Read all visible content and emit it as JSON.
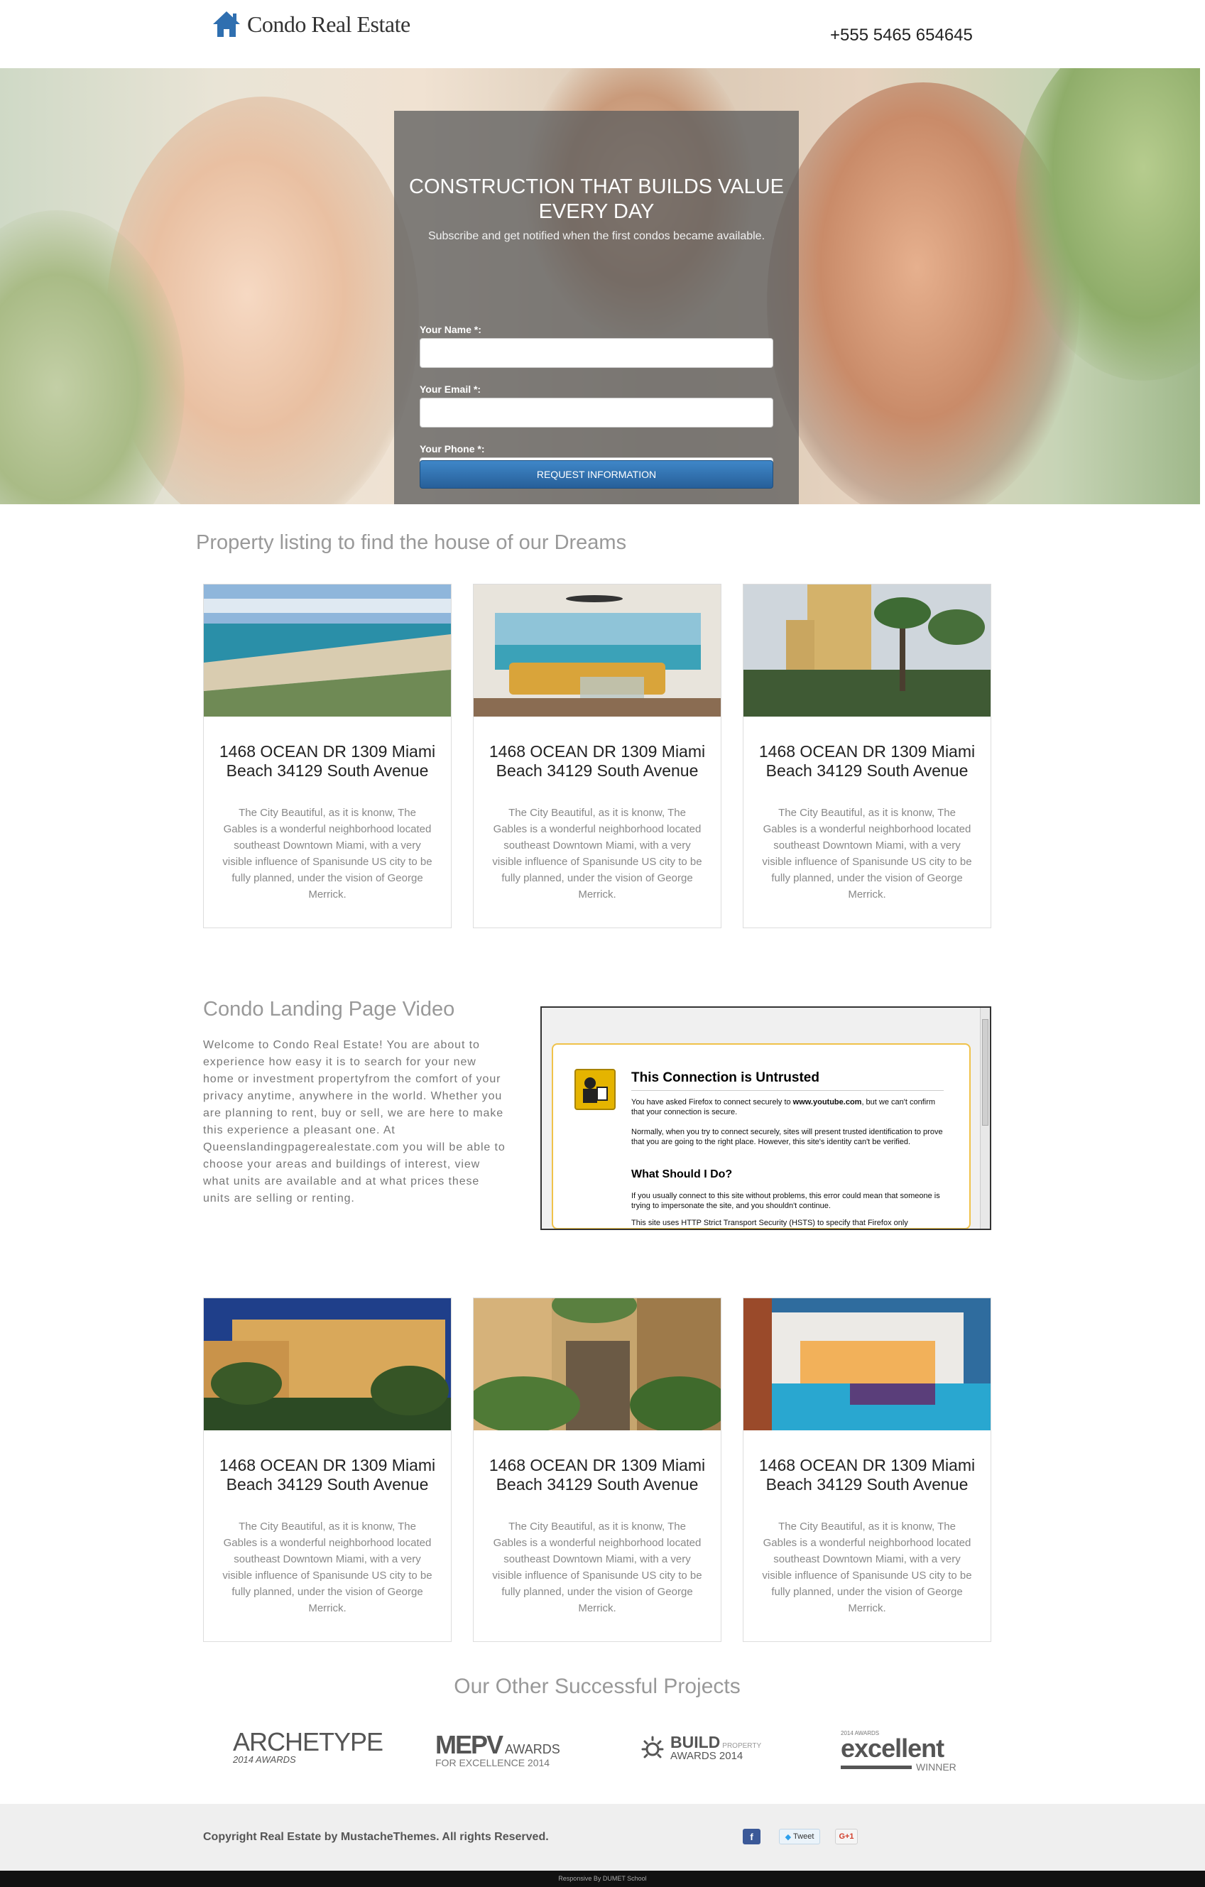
{
  "header": {
    "logo_text": "Condo Real Estate",
    "phone": "+555 5465 654645"
  },
  "hero": {
    "title": "CONSTRUCTION THAT BUILDS VALUE EVERY DAY",
    "subtitle": "Subscribe and get notified when the first condos became available.",
    "fields": [
      {
        "label": "Your Name *:",
        "value": ""
      },
      {
        "label": "Your Email *:",
        "value": ""
      },
      {
        "label": "Your Phone *:",
        "value": ""
      }
    ],
    "submit_label": "REQUEST INFORMATION"
  },
  "listing": {
    "heading": "Property listing to find the house of our Dreams",
    "cards": [
      {
        "title": "1468 OCEAN DR 1309 Miami Beach 34129 South Avenue",
        "desc": "The City Beautiful, as it is knonw, The Gables is a wonderful neighborhood located southeast Downtown Miami, with a very visible influence of Spanisunde US city to be fully planned, under the vision of George Merrick."
      },
      {
        "title": "1468 OCEAN DR 1309 Miami Beach 34129 South Avenue",
        "desc": "The City Beautiful, as it is knonw, The Gables is a wonderful neighborhood located southeast Downtown Miami, with a very visible influence of Spanisunde US city to be fully planned, under the vision of George Merrick."
      },
      {
        "title": "1468 OCEAN DR 1309 Miami Beach 34129 South Avenue",
        "desc": "The City Beautiful, as it is knonw, The Gables is a wonderful neighborhood located southeast Downtown Miami, with a very visible influence of Spanisunde US city to be fully planned, under the vision of George Merrick."
      },
      {
        "title": "1468 OCEAN DR 1309 Miami Beach 34129 South Avenue",
        "desc": "The City Beautiful, as it is knonw, The Gables is a wonderful neighborhood located southeast Downtown Miami, with a very visible influence of Spanisunde US city to be fully planned, under the vision of George Merrick."
      },
      {
        "title": "1468 OCEAN DR 1309 Miami Beach 34129 South Avenue",
        "desc": "The City Beautiful, as it is knonw, The Gables is a wonderful neighborhood located southeast Downtown Miami, with a very visible influence of Spanisunde US city to be fully planned, under the vision of George Merrick."
      },
      {
        "title": "1468 OCEAN DR 1309 Miami Beach 34129 South Avenue",
        "desc": "The City Beautiful, as it is knonw, The Gables is a wonderful neighborhood located southeast Downtown Miami, with a very visible influence of Spanisunde US city to be fully planned, under the vision of George Merrick."
      }
    ]
  },
  "video": {
    "heading": "Condo Landing Page Video",
    "text": "Welcome to Condo Real Estate! You are about to experience how easy it is to search for your new home or investment propertyfrom the comfort of your privacy anytime, anywhere in the world. Whether you are planning to rent, buy or sell, we are here to make this experience a pleasant one. At Queenslandingpagerealestate.com you will be able to choose your areas and buildings of interest, view what units are available and at what prices these units are selling or renting.",
    "embed": {
      "title": "This Connection is Untrusted",
      "p1_pre": "You have asked Firefox to connect securely to ",
      "p1_host": "www.youtube.com",
      "p1_post": ", but we can't confirm that your connection is secure.",
      "p2": "Normally, when you try to connect securely, sites will present trusted identification to prove that you are going to the right place. However, this site's identity can't be verified.",
      "subtitle": "What Should I Do?",
      "p3": "If you usually connect to this site without problems, this error could mean that someone is trying to impersonate the site, and you shouldn't continue.",
      "p4": "This site uses HTTP Strict Transport Security (HSTS) to specify that Firefox only"
    }
  },
  "projects": {
    "heading": "Our Other Successful Projects",
    "awards": [
      {
        "main": "ARCHETYPE",
        "sub": "2014 AWARDS"
      },
      {
        "main": "MEPV",
        "side": "AWARDS",
        "sub": "FOR EXCELLENCE 2014"
      },
      {
        "main": "BUILD",
        "side": "PROPERTY",
        "sub": "AWARDS 2014"
      },
      {
        "top": "2014 AWARDS",
        "main": "excellent",
        "sub": "WINNER"
      }
    ]
  },
  "footer": {
    "copyright": "Copyright Real Estate by MustacheThemes. All rights Reserved.",
    "social": [
      "f",
      "Tweet",
      "G+1"
    ],
    "credit": "Responsive By DUMET School"
  },
  "colors": {
    "accent_blue": "#2f6fb0",
    "heading_gray": "#999999",
    "footer_bg": "#efefef"
  }
}
